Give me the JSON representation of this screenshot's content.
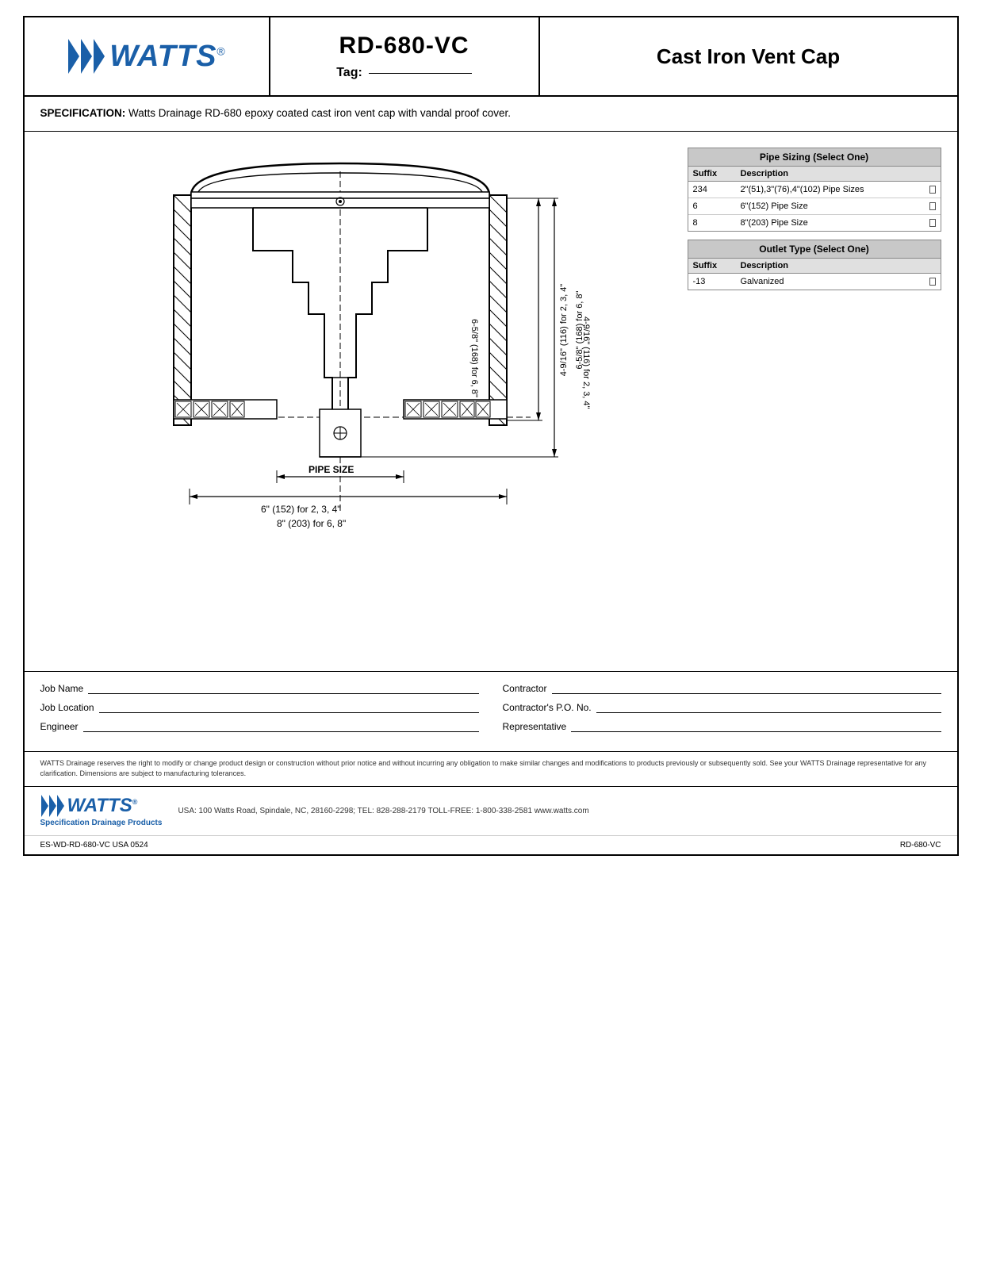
{
  "header": {
    "model_number": "RD-680-VC",
    "tag_label": "Tag:",
    "product_title": "Cast Iron Vent Cap"
  },
  "spec": {
    "label": "SPECIFICATION:",
    "text": " Watts Drainage RD-680 epoxy coated cast iron vent cap with vandal proof cover."
  },
  "pipe_sizing_table": {
    "title": "Pipe Sizing (Select One)",
    "col_suffix": "Suffix",
    "col_description": "Description",
    "rows": [
      {
        "suffix": "234",
        "description": "2\"(51),3\"(76),4\"(102) Pipe Sizes"
      },
      {
        "suffix": "6",
        "description": "6\"(152) Pipe Size"
      },
      {
        "suffix": "8",
        "description": "8\"(203) Pipe Size"
      }
    ]
  },
  "outlet_type_table": {
    "title": "Outlet Type (Select One)",
    "col_suffix": "Suffix",
    "col_description": "Description",
    "rows": [
      {
        "suffix": "-13",
        "description": "Galvanized"
      }
    ]
  },
  "dimensions": {
    "height_label_1": "4-9/16\" (116) for 2, 3, 4\"",
    "height_label_2": "6-5/8\" (168) for 6, 8\"",
    "pipe_size_label": "PIPE SIZE",
    "width_label_1": "6\" (152) for 2, 3, 4\"",
    "width_label_2": "8\" (203) for 6, 8\""
  },
  "form": {
    "job_name_label": "Job Name",
    "contractor_label": "Contractor",
    "job_location_label": "Job Location",
    "contractors_po_label": "Contractor's P.O. No.",
    "engineer_label": "Engineer",
    "representative_label": "Representative"
  },
  "disclaimer": {
    "text": "WATTS Drainage reserves the right to modify or change product design or construction without prior notice and without incurring any obligation to make similar changes and modifications to products previously or subsequently sold.  See your WATTS Drainage representative for any clarification.   Dimensions are subject to manufacturing tolerances."
  },
  "footer": {
    "tagline": "Specification Drainage Products",
    "address": "USA:  100 Watts Road, Spindale, NC, 28160-2298;  TEL: 828-288-2179  TOLL-FREE: 1-800-338-2581  www.watts.com"
  },
  "meta": {
    "part_number_left": "ES-WD-RD-680-VC USA 0524",
    "part_number_right": "RD-680-VC"
  }
}
